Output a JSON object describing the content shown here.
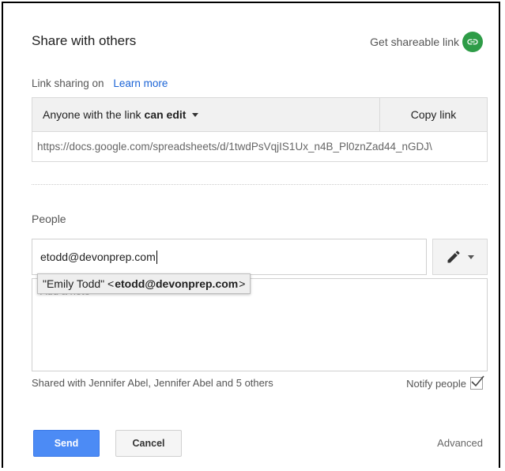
{
  "dialog": {
    "title": "Share with others",
    "shareable_link_label": "Get shareable link",
    "shareable_link_icon": "link-icon",
    "link_sharing_label": "Link sharing on",
    "learn_more": "Learn more",
    "access": {
      "prefix": "Anyone with the link",
      "level": "can edit"
    },
    "copy_link_label": "Copy link",
    "url": "https://docs.google.com/spreadsheets/d/1twdPsVqjIS1Ux_n4B_Pl0znZad44_nGDJ\\",
    "people_label": "People",
    "people_input_value": "etodd@devonprep.com",
    "permission_icon": "pencil-icon",
    "note_placeholder": "Add a note",
    "suggestion": {
      "name": "\"Emily Todd\" <",
      "email": "etodd@devonprep.com",
      "suffix": ">"
    },
    "shared_with": "Shared with Jennifer Abel, Jennifer Abel and 5 others",
    "notify_label": "Notify people",
    "notify_checked": true,
    "send_label": "Send",
    "cancel_label": "Cancel",
    "advanced_label": "Advanced"
  },
  "colors": {
    "accent_blue": "#4c8bf5",
    "link_blue": "#1a63d6",
    "shareable_green": "#2e9c47"
  }
}
